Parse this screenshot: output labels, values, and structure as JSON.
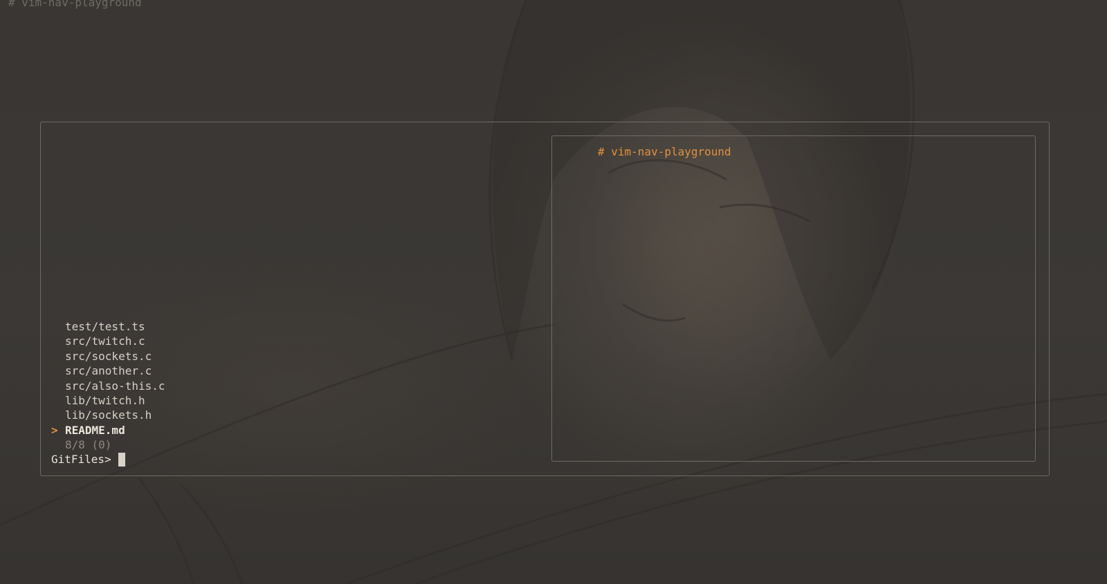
{
  "buffer": {
    "first_line": "# vim-nav-playground"
  },
  "preview": {
    "content_line": "# vim-nav-playground"
  },
  "fzf": {
    "files": [
      "test/test.ts",
      "src/twitch.c",
      "src/sockets.c",
      "src/another.c",
      "src/also-this.c",
      "lib/twitch.h",
      "lib/sockets.h",
      "README.md"
    ],
    "selected_index": 7,
    "pointer": ">",
    "counter": "8/8 (0)",
    "prompt": "GitFiles>",
    "query": ""
  },
  "colors": {
    "background": "#3a3734",
    "accent": "#e0913e",
    "border": "#6f6b66",
    "text": "#d6d0c6"
  }
}
